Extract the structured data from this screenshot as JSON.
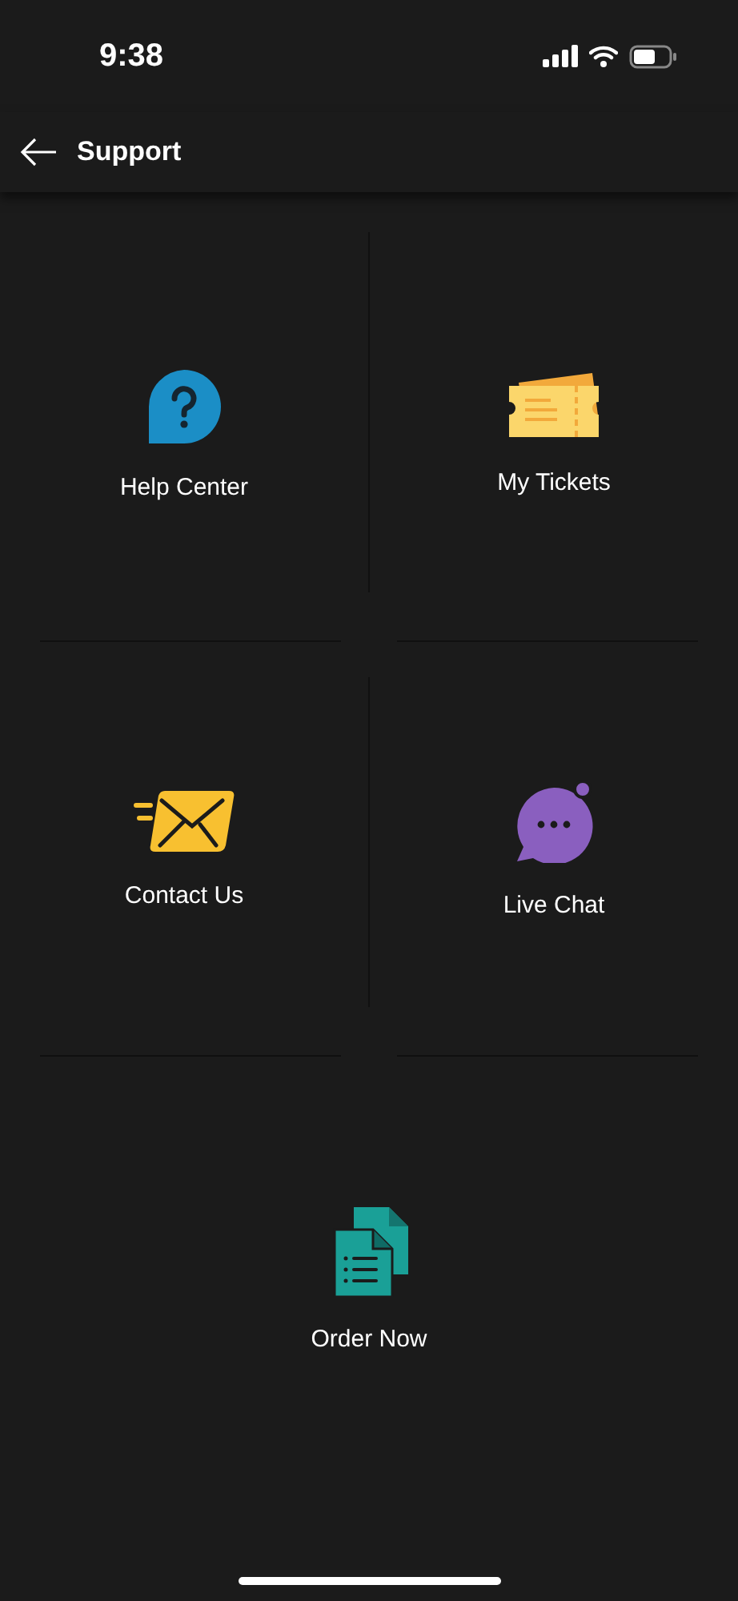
{
  "status_bar": {
    "time": "9:38"
  },
  "header": {
    "title": "Support"
  },
  "items": [
    {
      "label": "Help Center",
      "kind": "help"
    },
    {
      "label": "My Tickets",
      "kind": "tickets"
    },
    {
      "label": "Contact Us",
      "kind": "mail"
    },
    {
      "label": "Live Chat",
      "kind": "chat"
    },
    {
      "label": "Order Now",
      "kind": "docs"
    }
  ]
}
